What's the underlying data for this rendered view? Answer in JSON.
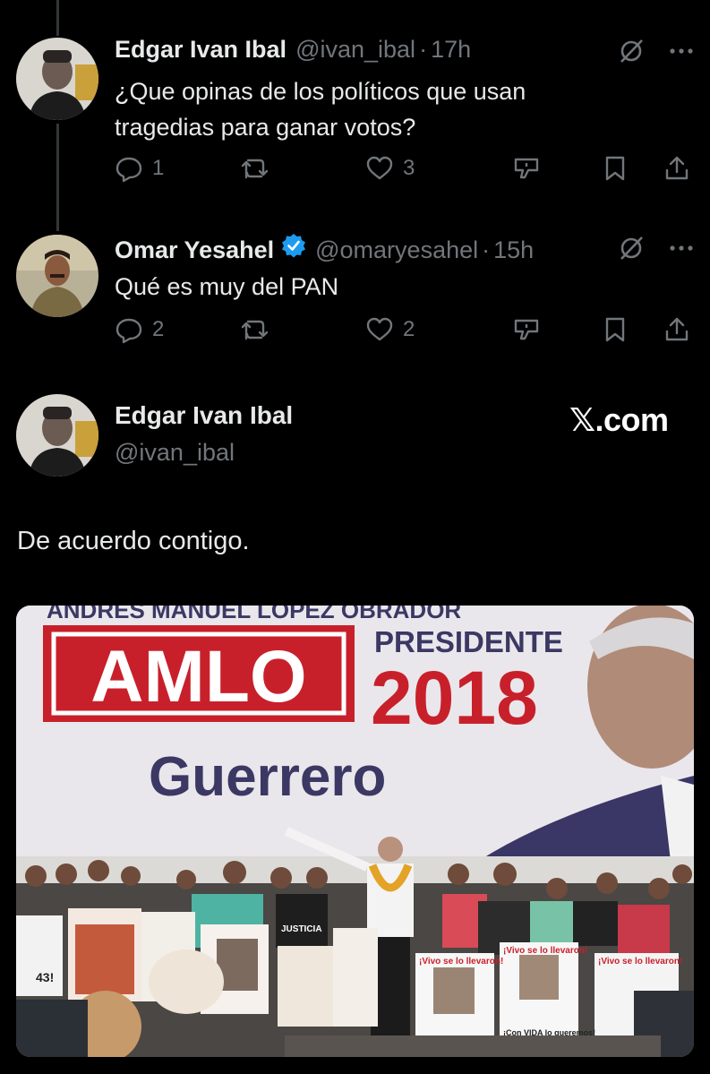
{
  "tweets": [
    {
      "name": "Edgar Ivan Ibal",
      "handle": "@ivan_ibal",
      "time": "17h",
      "text_lines": [
        "¿Que opinas de los políticos que usan",
        "tragedias para ganar votos?"
      ],
      "replies": "1",
      "retweets": "",
      "likes": "3"
    },
    {
      "name": "Omar Yesahel",
      "handle": "@omaryesahel",
      "time": "15h",
      "verified": true,
      "text_lines": [
        "Qué es muy del PAN"
      ],
      "replies": "2",
      "retweets": "",
      "likes": "2"
    }
  ],
  "quote": {
    "name": "Edgar Ivan Ibal",
    "handle": "@ivan_ibal",
    "site_label": "𝕏.com",
    "text": "De acuerdo contigo.",
    "image": {
      "banner_top": "ANDRES MANUEL LOPEZ OBRADOR",
      "banner_brand": "AMLO",
      "banner_presidente": "PRESIDENTE",
      "banner_year": "2018",
      "banner_state": "Guerrero",
      "poster_texts": [
        "¡Vivo se lo llevaron!",
        "JUSTICIA",
        "43!",
        "¡Con VIDA lo queremos!"
      ]
    }
  },
  "colors": {
    "background": "#000000",
    "text": "#e7e9ea",
    "muted": "#71767b",
    "verified": "#1d9bf0",
    "banner_red": "#c8202b",
    "banner_navy": "#3b3864"
  },
  "icons": [
    "reply-icon",
    "retweet-icon",
    "like-icon",
    "grok-icon",
    "bookmark-icon",
    "share-icon",
    "no-translate-icon",
    "more-icon",
    "verified-icon"
  ]
}
